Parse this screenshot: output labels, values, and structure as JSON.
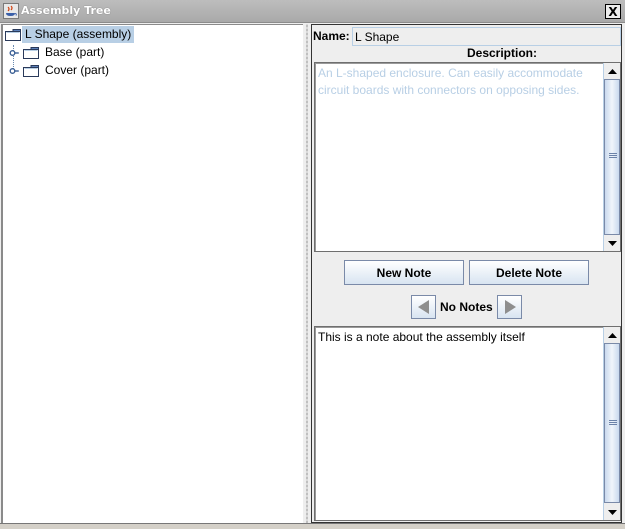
{
  "window": {
    "title": "Assembly Tree",
    "close_label": "X"
  },
  "tree": {
    "root": {
      "label": "L Shape (assembly)",
      "icon": "folder-icon",
      "selected": true
    },
    "children": [
      {
        "label": "Base (part)",
        "icon": "folder-icon",
        "expander": "collapsed"
      },
      {
        "label": "Cover (part)",
        "icon": "folder-icon",
        "expander": "collapsed"
      }
    ]
  },
  "details": {
    "name_label": "Name:",
    "name_value": "L Shape",
    "description_label": "Description:",
    "description_text": "An L-shaped enclosure. Can easily accommodate circuit boards with connectors on opposing sides.",
    "buttons": {
      "new_note": "New Note",
      "delete_note": "Delete Note"
    },
    "notes_nav": {
      "prev_icon": "arrow-left-icon",
      "status": "No Notes",
      "next_icon": "arrow-right-icon"
    },
    "note_text": "This is a note about the assembly itself"
  },
  "colors": {
    "selection": "#b8cfe5",
    "description_text": "#b8cfe5",
    "button_border": "#7a8aa8"
  }
}
